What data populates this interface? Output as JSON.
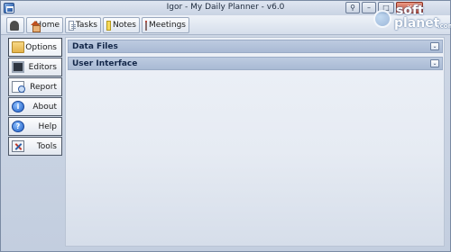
{
  "window": {
    "title": "Igor - My Daily Planner - v6.0",
    "buttons": {
      "close_glyph": "✕",
      "max_glyph": "□",
      "min_glyph": "–",
      "pin_glyph": "⚲"
    }
  },
  "toolbar": {
    "items": [
      {
        "label": "Home",
        "icon": "home-icon"
      },
      {
        "label": "Tasks",
        "icon": "document-icon"
      },
      {
        "label": "Notes",
        "icon": "notes-icon"
      },
      {
        "label": "Meetings",
        "icon": "calendar-icon"
      }
    ],
    "toggle_icon": "toggle-icon"
  },
  "sidebar": {
    "items": [
      {
        "label": "Options",
        "icon": "folder-icon",
        "active": true
      },
      {
        "label": "Editors",
        "icon": "monitor-icon"
      },
      {
        "label": "Report",
        "icon": "report-icon"
      },
      {
        "label": "About",
        "icon": "info-icon",
        "glyph": "i"
      },
      {
        "label": "Help",
        "icon": "help-icon",
        "glyph": "?"
      },
      {
        "label": "Tools",
        "icon": "tools-icon"
      }
    ]
  },
  "content": {
    "groups": [
      {
        "label": "Data Files",
        "expand_glyph": "⌄"
      },
      {
        "label": "User Interface",
        "expand_glyph": "⌄"
      }
    ]
  },
  "watermark": {
    "line1": "soft",
    "line2": "planet",
    "suffix": ".com"
  },
  "colors": {
    "group_header": "#a9bad4",
    "close_button": "#c0432b",
    "accent_blue": "#1f5fc4"
  }
}
